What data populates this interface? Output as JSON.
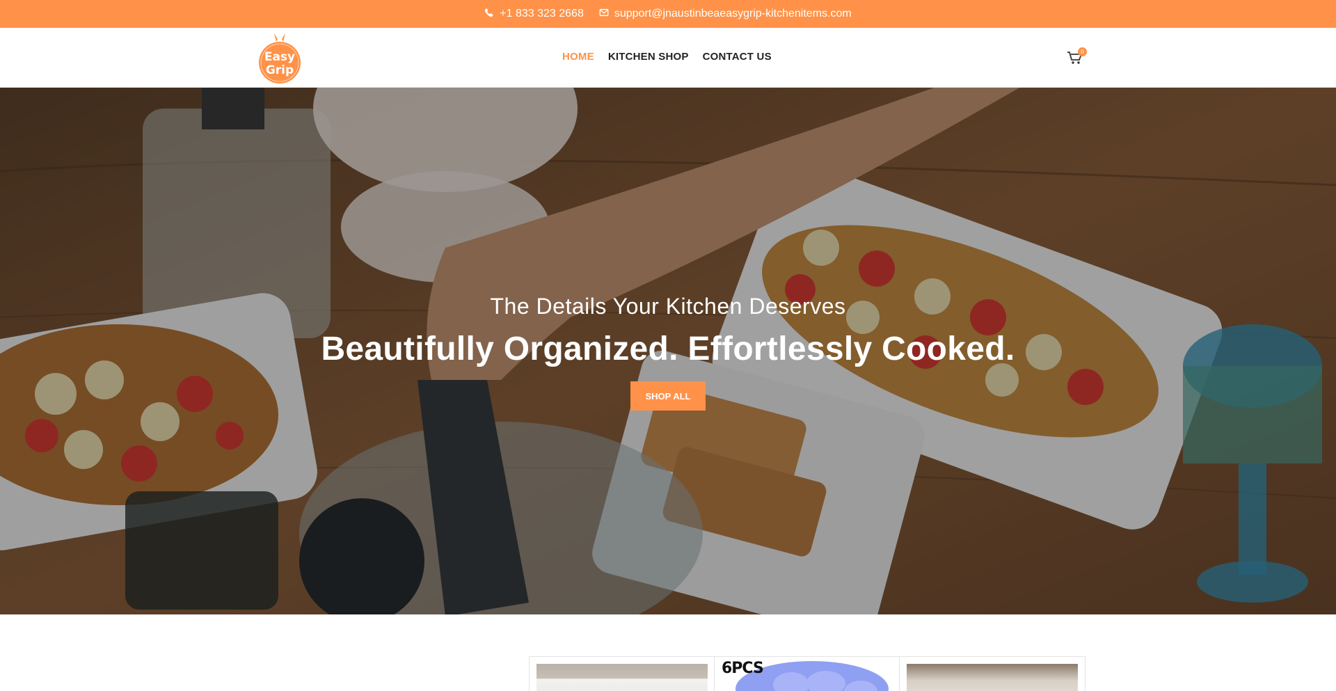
{
  "topbar": {
    "phone": "+1 833 323 2668",
    "email": "support@jnaustinbeaeasygrip-kitchenitems.com",
    "icons": [
      "phone-icon",
      "mail-icon"
    ]
  },
  "header": {
    "logo_alt": "Easy Grip",
    "logo_line1": "Easy",
    "logo_line2": "Grip",
    "nav": [
      {
        "label": "HOME",
        "active": true
      },
      {
        "label": "KITCHEN SHOP",
        "active": false
      },
      {
        "label": "CONTACT US",
        "active": false
      }
    ],
    "cart_count": "0"
  },
  "hero": {
    "subtitle": "The Details Your Kitchen Deserves",
    "title": "Beautifully Organized. Effortlessly Cooked.",
    "button_label": "SHOP ALL"
  },
  "products": [
    {
      "badge": ""
    },
    {
      "badge": "6PCS"
    },
    {
      "badge": ""
    }
  ],
  "colors": {
    "accent": "#ff9248",
    "text": "#222222"
  }
}
